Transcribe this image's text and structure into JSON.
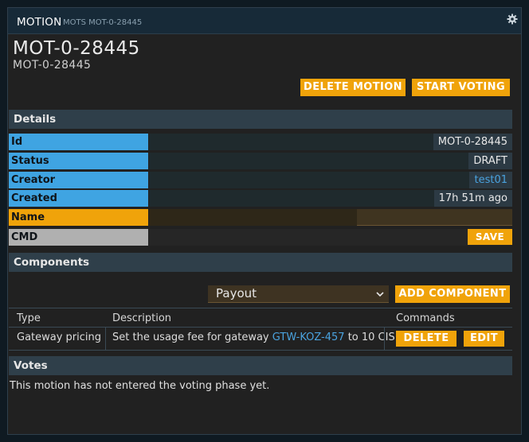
{
  "window": {
    "title": "MOTION",
    "subtitle": "MOTS MOT-0-28445",
    "settings_icon": "gear-icon"
  },
  "header": {
    "heading": "MOT-0-28445",
    "subheading": "MOT-0-28445",
    "delete_label": "DELETE MOTION",
    "start_label": "START VOTING"
  },
  "details": {
    "section_title": "Details",
    "rows": [
      {
        "label": "Id",
        "value": "MOT-0-28445"
      },
      {
        "label": "Status",
        "value": "DRAFT"
      },
      {
        "label": "Creator",
        "value": "test01"
      },
      {
        "label": "Created",
        "value": "17h 51m ago"
      },
      {
        "label": "Name",
        "value": ""
      },
      {
        "label": "CMD",
        "value": ""
      }
    ],
    "save_label": "SAVE"
  },
  "components": {
    "section_title": "Components",
    "selected_type": "Payout",
    "add_label": "ADD COMPONENT",
    "columns": [
      "Type",
      "Description",
      "Commands"
    ],
    "rows": [
      {
        "type": "Gateway pricing",
        "desc_prefix": "Set the usage fee for gateway ",
        "desc_link": "GTW-KOZ-457",
        "desc_suffix": " to 10 CIS.",
        "delete_label": "DELETE",
        "edit_label": "EDIT"
      }
    ]
  },
  "votes": {
    "section_title": "Votes",
    "message": "This motion has not entered the voting phase yet."
  },
  "colors": {
    "accent": "#f0a30a",
    "label_blue": "#3fa4e2",
    "link": "#4aa3df",
    "titlebar": "#172a38"
  }
}
